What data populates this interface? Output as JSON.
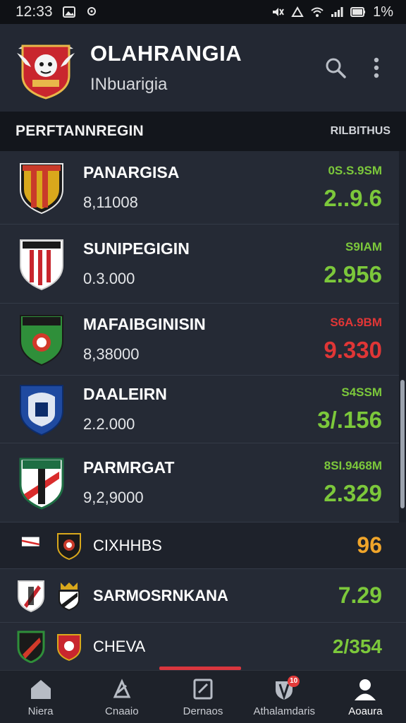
{
  "status_bar": {
    "time": "12:33",
    "battery": "1%"
  },
  "header": {
    "title": "OLAHRANGIA",
    "subtitle": "INbuarigia"
  },
  "section_main": {
    "title": "PERFTANNREGIN",
    "right_label": "RILBITHUS"
  },
  "teams": [
    {
      "name": "PANARGISA",
      "sub": "8,11008",
      "small": "0S.S.9SM",
      "big": "2..9.6",
      "color": "#7cc83b",
      "crest_colors": [
        "#d9a81c",
        "#c93a2a",
        "#1a1a1a"
      ]
    },
    {
      "name": "SUNIPEGIGIN",
      "sub": "0.3.000",
      "small": "S9IAM",
      "big": "2.956",
      "color": "#7cc83b",
      "crest_colors": [
        "#ffffff",
        "#c8262e",
        "#1a1a1a"
      ]
    },
    {
      "name": "MAFAIBGINISIN",
      "sub": "8,38000",
      "small": "S6A.9BM",
      "big": "9.330",
      "color": "#e03636",
      "crest_colors": [
        "#2f8f3a",
        "#d23a2a",
        "#ffffff"
      ]
    },
    {
      "name": "DAALEIRN",
      "sub": "2.2.000",
      "small": "S4SSM",
      "big": "3/.156",
      "color": "#7cc83b",
      "crest_colors": [
        "#1f4aa0",
        "#dfe6f2",
        "#0d2c6a"
      ]
    },
    {
      "name": "PARMRGAT",
      "sub": "9,2,9000",
      "small": "8SI.9468M",
      "big": "2.329",
      "color": "#7cc83b",
      "crest_colors": [
        "#1e6e43",
        "#d92c2c",
        "#ffffff"
      ]
    }
  ],
  "group": {
    "name": "CIXHHBS",
    "value": "96",
    "color": "#f0a52a"
  },
  "mini_rows": [
    {
      "name": "SARMOSRNKANA",
      "value": "7.29",
      "color": "#7cc83b"
    },
    {
      "name": "CHEVA",
      "value": "2/354",
      "color": "#7cc83b"
    }
  ],
  "nav": [
    {
      "label": "Niera",
      "icon": "home-icon"
    },
    {
      "label": "Cnaaio",
      "icon": "trophy-icon"
    },
    {
      "label": "Dernaos",
      "icon": "edit-icon"
    },
    {
      "label": "Athalamdaris",
      "icon": "shield-icon",
      "badge": "10"
    },
    {
      "label": "Aoaura",
      "icon": "profile-icon",
      "active": true
    }
  ]
}
